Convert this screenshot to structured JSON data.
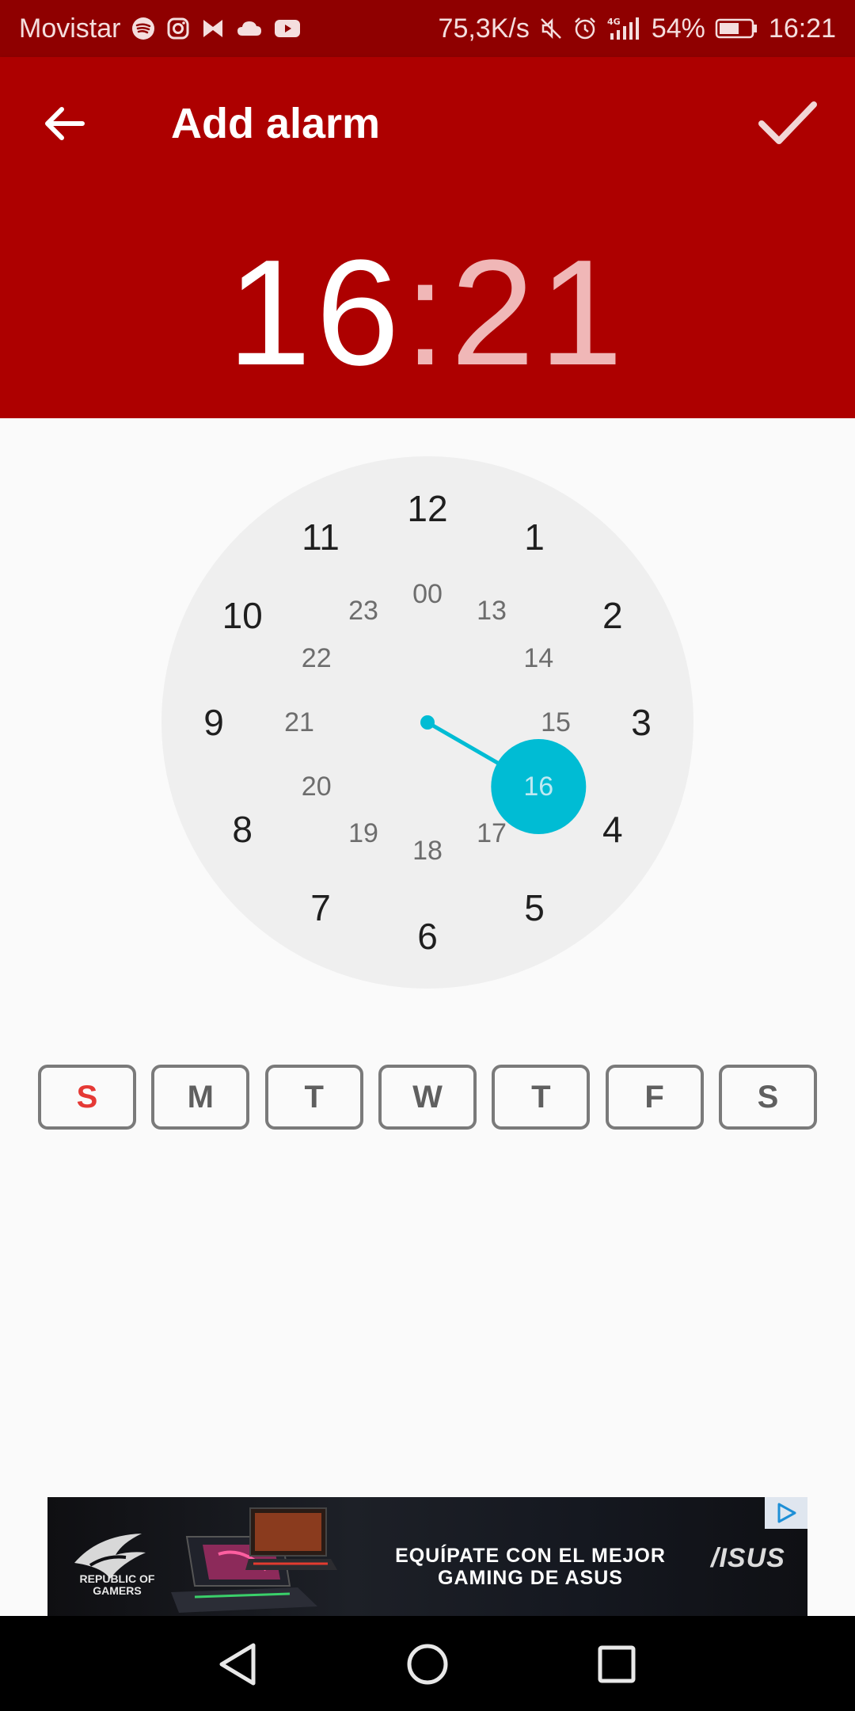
{
  "status_bar": {
    "carrier": "Movistar",
    "network_speed": "75,3K/s",
    "battery": "54%",
    "time": "16:21",
    "icons": [
      "spotify-icon",
      "instagram-icon",
      "bowtie-icon",
      "cloud-icon",
      "youtube-icon",
      "mute-icon",
      "alarm-icon",
      "signal-4g-icon",
      "battery-icon"
    ]
  },
  "app_bar": {
    "title": "Add alarm",
    "back_icon": "arrow-back-icon",
    "confirm_icon": "check-icon"
  },
  "time": {
    "hour": "16",
    "separator": ":",
    "minute": "21"
  },
  "clock": {
    "outer_numbers": [
      "12",
      "1",
      "2",
      "3",
      "4",
      "5",
      "6",
      "7",
      "8",
      "9",
      "10",
      "11"
    ],
    "inner_numbers": [
      "00",
      "13",
      "14",
      "15",
      "16",
      "17",
      "18",
      "19",
      "20",
      "21",
      "22",
      "23"
    ],
    "selected": "16",
    "accent_color": "#00bcd4"
  },
  "days": [
    {
      "label": "S",
      "active": true
    },
    {
      "label": "M",
      "active": false
    },
    {
      "label": "T",
      "active": false
    },
    {
      "label": "W",
      "active": false
    },
    {
      "label": "T",
      "active": false
    },
    {
      "label": "F",
      "active": false
    },
    {
      "label": "S",
      "active": false
    }
  ],
  "ad": {
    "logo_text": "REPUBLIC OF GAMERS",
    "headline_line1": "EQUÍPATE CON EL MEJOR",
    "headline_line2": "GAMING DE ASUS",
    "brand": "/ISUS"
  },
  "colors": {
    "app_bar": "#ad0000",
    "status_bar": "#8f0000",
    "selected_day": "#e53935"
  }
}
